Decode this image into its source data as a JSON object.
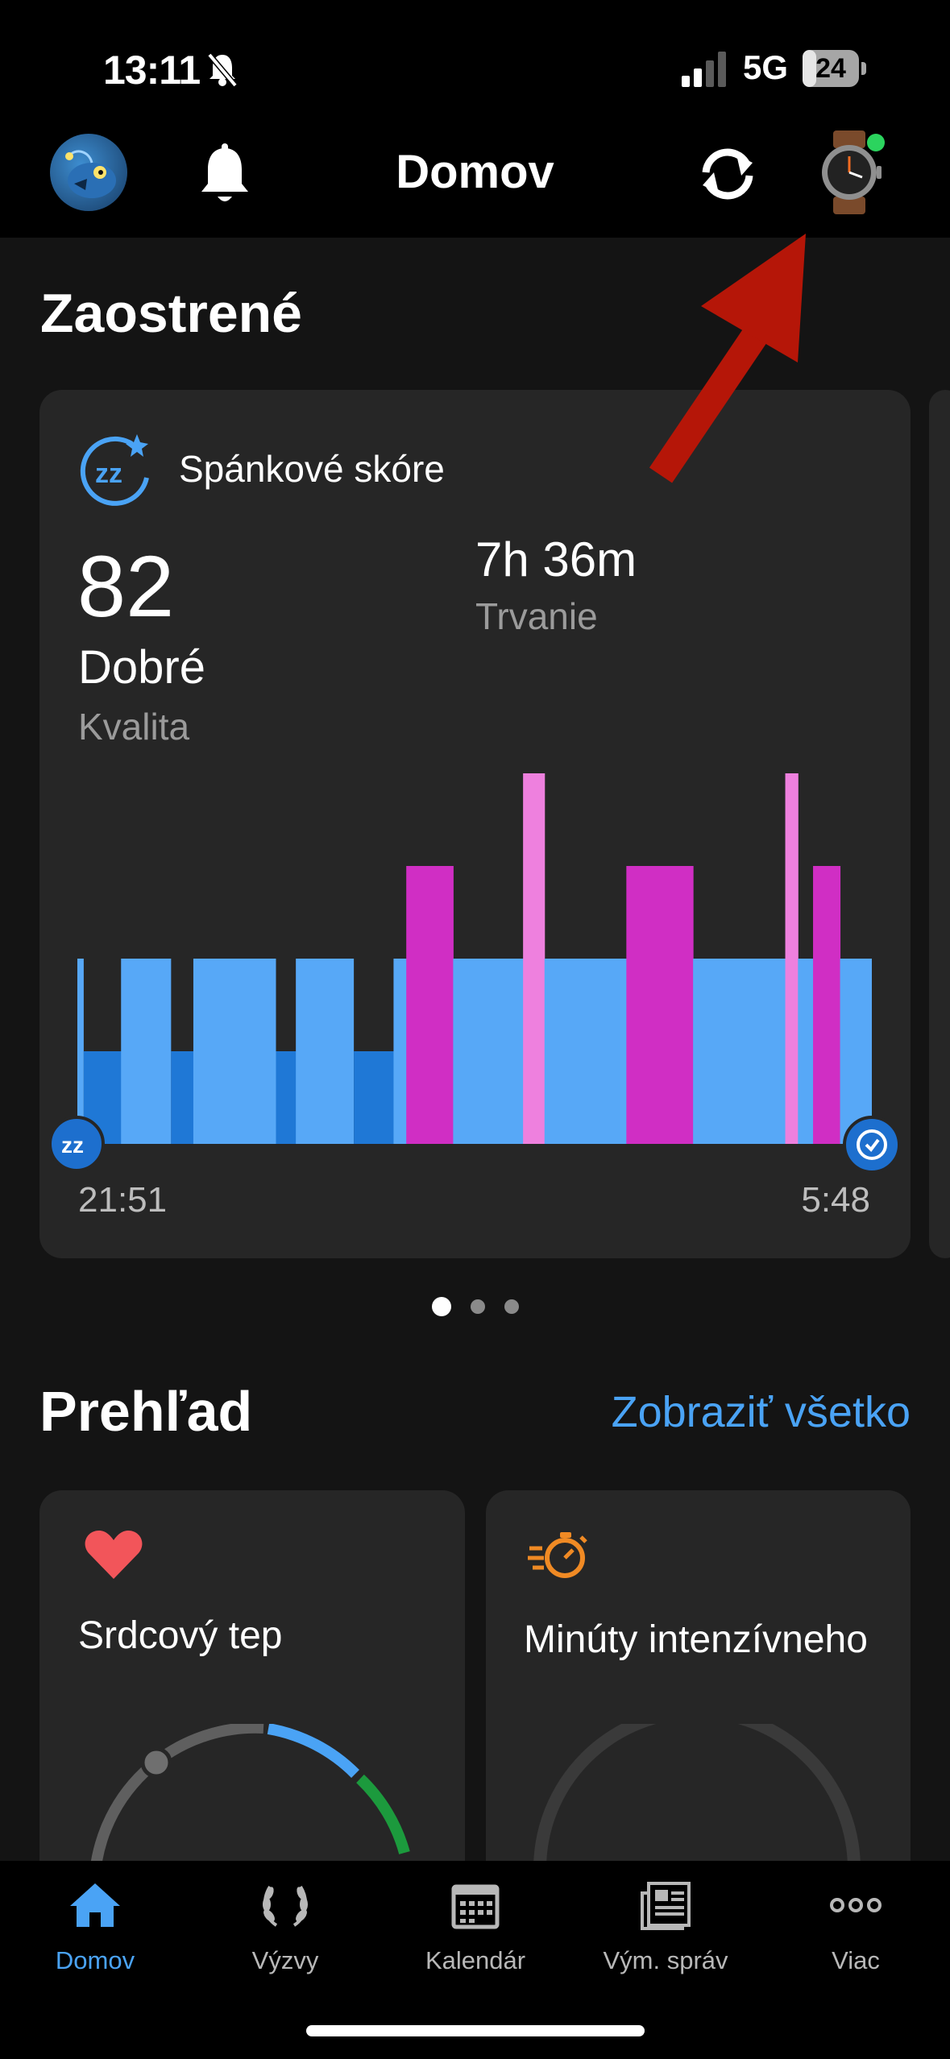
{
  "status_bar": {
    "time": "13:11",
    "network": "5G",
    "battery": "24",
    "battery_level": 0.24
  },
  "header": {
    "title": "Domov",
    "icons": [
      "avatar",
      "bell-icon",
      "sync-icon",
      "watch-icon"
    ]
  },
  "focus": {
    "title": "Zaostrené",
    "sleep": {
      "label": "Spánkové skóre",
      "score": "82",
      "quality_value": "Dobré",
      "quality_label": "Kvalita",
      "duration_value": "7h 36m",
      "duration_label": "Trvanie",
      "start_time": "21:51",
      "end_time": "5:48",
      "colors": {
        "deep": "#1f78d6",
        "light": "#57a8f7",
        "rem": "#d02ec4",
        "awake": "#ee80de"
      }
    },
    "page_count": 3,
    "active_page": 0
  },
  "overview": {
    "title": "Prehľad",
    "show_all": "Zobraziť všetko",
    "tiles": [
      {
        "label": "Srdcový tep",
        "icon": "heart-icon"
      },
      {
        "label": "Minúty intenzívneho",
        "icon": "stopwatch-icon"
      }
    ]
  },
  "tabs": [
    {
      "label": "Domov",
      "icon": "home-icon",
      "active": true
    },
    {
      "label": "Výzvy",
      "icon": "laurel-icon",
      "active": false
    },
    {
      "label": "Kalendár",
      "icon": "calendar-icon",
      "active": false
    },
    {
      "label": "Vým. správ",
      "icon": "news-icon",
      "active": false
    },
    {
      "label": "Viac",
      "icon": "more-icon",
      "active": false
    }
  ],
  "chart_data": {
    "type": "bar",
    "x_range": [
      "21:51",
      "5:48"
    ],
    "levels": {
      "deep": 1,
      "light": 2,
      "rem": 3,
      "awake": 4
    },
    "segments": [
      {
        "stage": "light",
        "start": 0.0,
        "end": 0.008
      },
      {
        "stage": "deep",
        "start": 0.008,
        "end": 0.055
      },
      {
        "stage": "light",
        "start": 0.055,
        "end": 0.118
      },
      {
        "stage": "deep",
        "start": 0.118,
        "end": 0.146
      },
      {
        "stage": "light",
        "start": 0.146,
        "end": 0.25
      },
      {
        "stage": "deep",
        "start": 0.25,
        "end": 0.275
      },
      {
        "stage": "light",
        "start": 0.275,
        "end": 0.348
      },
      {
        "stage": "deep",
        "start": 0.348,
        "end": 0.398
      },
      {
        "stage": "light",
        "start": 0.398,
        "end": 0.414
      },
      {
        "stage": "rem",
        "start": 0.414,
        "end": 0.473
      },
      {
        "stage": "light",
        "start": 0.473,
        "end": 0.561
      },
      {
        "stage": "awake",
        "start": 0.561,
        "end": 0.588
      },
      {
        "stage": "light",
        "start": 0.588,
        "end": 0.691
      },
      {
        "stage": "rem",
        "start": 0.691,
        "end": 0.775
      },
      {
        "stage": "light",
        "start": 0.775,
        "end": 0.891
      },
      {
        "stage": "awake",
        "start": 0.891,
        "end": 0.907
      },
      {
        "stage": "light",
        "start": 0.907,
        "end": 0.926
      },
      {
        "stage": "rem",
        "start": 0.926,
        "end": 0.96
      },
      {
        "stage": "light",
        "start": 0.96,
        "end": 1.0
      }
    ]
  }
}
